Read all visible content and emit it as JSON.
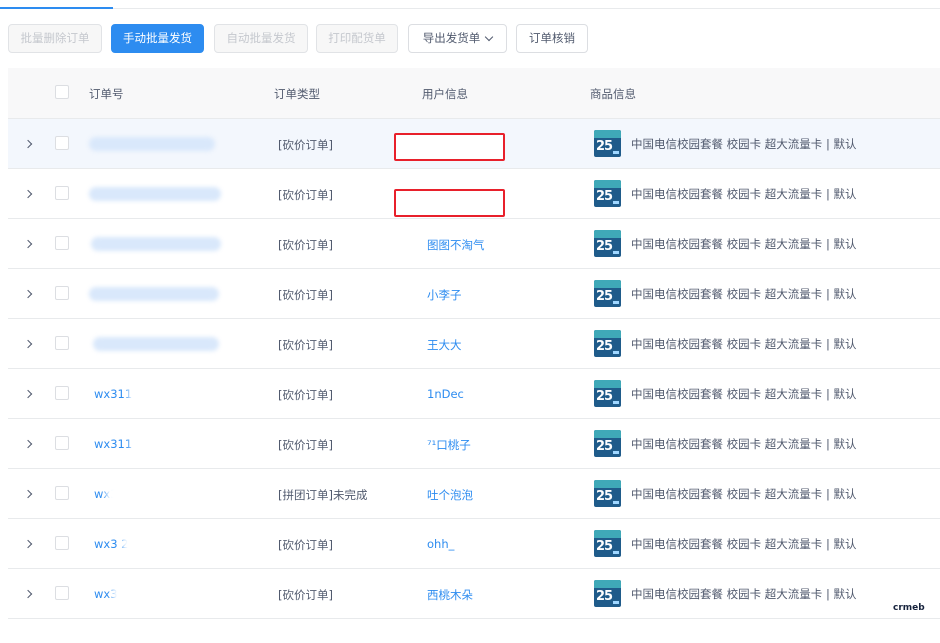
{
  "toolbar": {
    "batch_delete": "批量删除订单",
    "manual_ship": "手动批量发货",
    "auto_ship": "自动批量发货",
    "print_picking": "打印配货单",
    "export_shipping": "导出发货单",
    "order_verify": "订单核销"
  },
  "table": {
    "headers": {
      "order_no": "订单号",
      "order_type": "订单类型",
      "user_info": "用户信息",
      "product_info": "商品信息"
    },
    "rows": [
      {
        "order_no": "",
        "order_type": "[砍价订单]",
        "user": "",
        "product_thumb_text": "25",
        "product_name": "中国电信校园套餐 校园卡 超大流量卡 | 默认"
      },
      {
        "order_no": "",
        "order_type": "[砍价订单]",
        "user": "",
        "product_thumb_text": "25",
        "product_name": "中国电信校园套餐 校园卡 超大流量卡 | 默认"
      },
      {
        "order_no": "",
        "order_type": "[砍价订单]",
        "user": "图图不淘气",
        "product_thumb_text": "25",
        "product_name": "中国电信校园套餐 校园卡 超大流量卡 | 默认"
      },
      {
        "order_no": "",
        "order_type": "[砍价订单]",
        "user": "小李子",
        "product_thumb_text": "25",
        "product_name": "中国电信校园套餐 校园卡 超大流量卡 | 默认"
      },
      {
        "order_no": "",
        "order_type": "[砍价订单]",
        "user": "王大大",
        "product_thumb_text": "25",
        "product_name": "中国电信校园套餐 校园卡 超大流量卡 | 默认"
      },
      {
        "order_no": "wx311",
        "order_type": "[砍价订单]",
        "user": "1nDec",
        "product_thumb_text": "25",
        "product_name": "中国电信校园套餐 校园卡 超大流量卡 | 默认"
      },
      {
        "order_no": "wx311                80",
        "order_type": "[砍价订单]",
        "user": "⁷¹口桃子",
        "product_thumb_text": "25",
        "product_name": "中国电信校园套餐 校园卡 超大流量卡 | 默认"
      },
      {
        "order_no": "wx3                  8",
        "order_type": "[拼团订单]未完成",
        "user": "吐个泡泡",
        "product_thumb_text": "25",
        "product_name": "中国电信校园套餐 校园卡 超大流量卡 | 默认"
      },
      {
        "order_no": "wx3              208",
        "order_type": "[砍价订单]",
        "user": "ohh_",
        "product_thumb_text": "25",
        "product_name": "中国电信校园套餐 校园卡 超大流量卡 | 默认"
      },
      {
        "order_no": "wx3               776",
        "order_type": "[砍价订单]",
        "user": "西桃木朵",
        "product_thumb_text": "25",
        "product_name": "中国电信校园套餐 校园卡 超大流量卡 | 默认"
      }
    ]
  },
  "watermark": "crmeb",
  "colors": {
    "primary": "#2d8cf0",
    "redact": "#e8202b",
    "header_bg": "#f8f8f9"
  }
}
